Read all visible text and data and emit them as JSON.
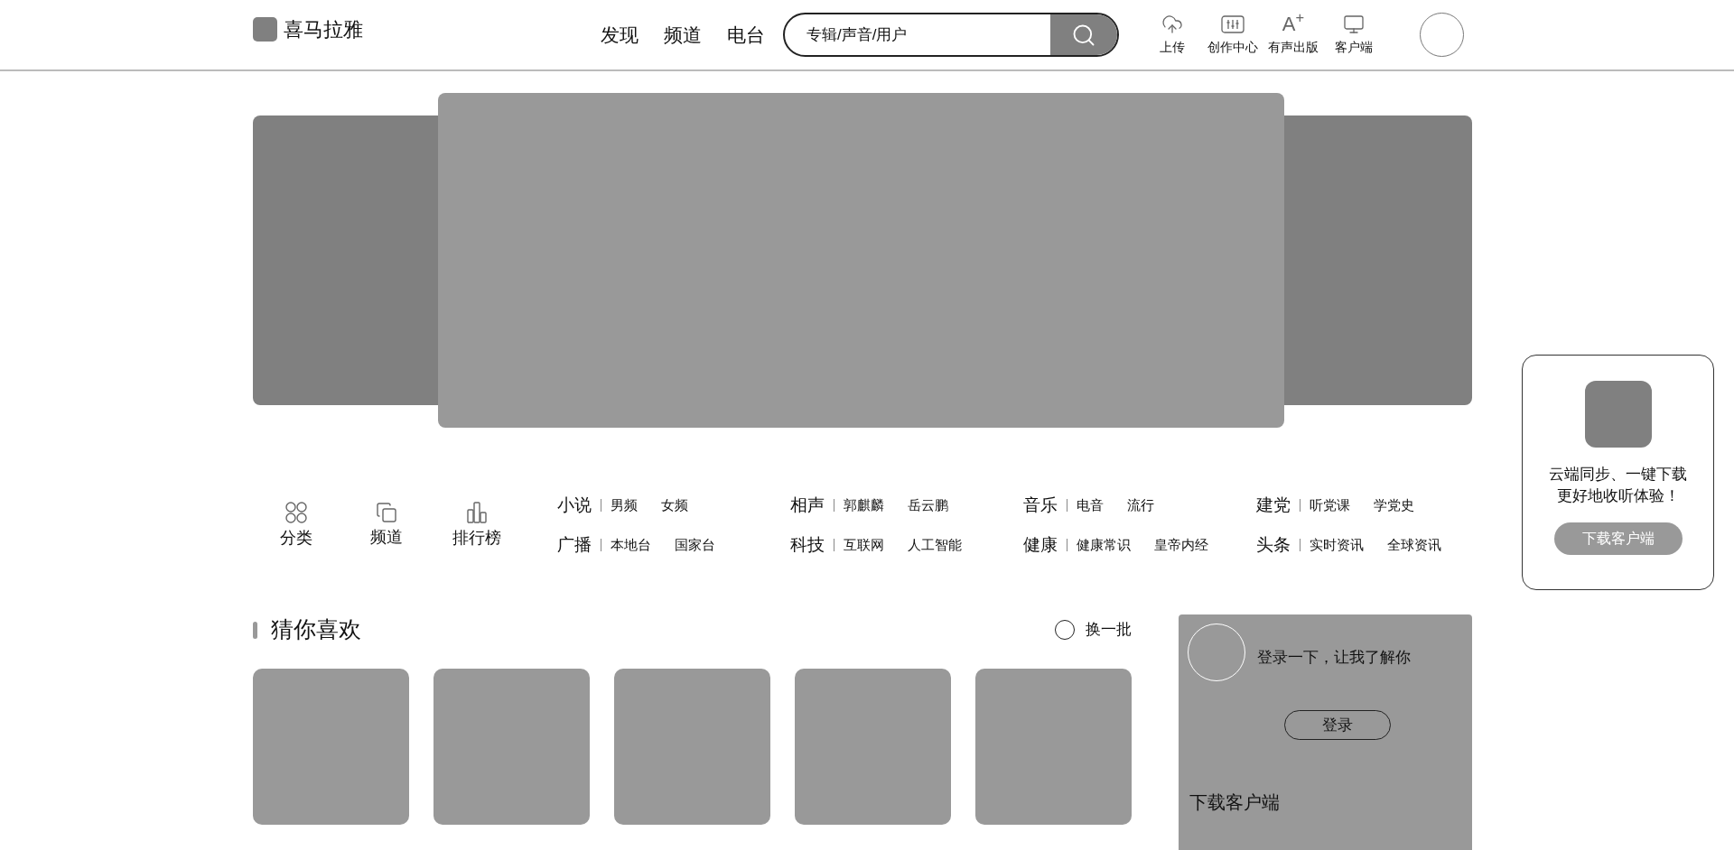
{
  "header": {
    "logo": "喜马拉雅",
    "nav": [
      {
        "label": "发现"
      },
      {
        "label": "频道"
      },
      {
        "label": "电台"
      }
    ],
    "search": {
      "placeholder": "专辑/声音/用户"
    },
    "tools": [
      {
        "kind": "upload",
        "label": "上传"
      },
      {
        "kind": "sliders",
        "label": "创作中心"
      },
      {
        "kind": "glyph",
        "glyph": "A$^{+}$",
        "label": "有声出版"
      },
      {
        "kind": "monitor",
        "label": "客户端"
      }
    ]
  },
  "shortcuts": [
    {
      "kind": "grid",
      "label": "分类"
    },
    {
      "kind": "copy",
      "label": "频道"
    },
    {
      "kind": "bars",
      "label": "排行榜"
    }
  ],
  "category_columns": [
    [
      {
        "name": "小说",
        "links": [
          "男频",
          "女频"
        ]
      },
      {
        "name": "广播",
        "links": [
          "本地台",
          "国家台"
        ]
      }
    ],
    [
      {
        "name": "相声",
        "links": [
          "郭麒麟",
          "岳云鹏"
        ]
      },
      {
        "name": "科技",
        "links": [
          "互联网",
          "人工智能"
        ]
      }
    ],
    [
      {
        "name": "音乐",
        "links": [
          "电音",
          "流行"
        ]
      },
      {
        "name": "健康",
        "links": [
          "健康常识",
          "皇帝内经"
        ]
      }
    ],
    [
      {
        "name": "建党",
        "links": [
          "听党课",
          "学党史"
        ]
      },
      {
        "name": "头条",
        "links": [
          "实时资讯",
          "全球资讯"
        ]
      }
    ]
  ],
  "recommend": {
    "title": "猜你喜欢",
    "refresh": "换一批",
    "items": [
      {
        "kind": "placeholder"
      },
      {
        "kind": "placeholder"
      },
      {
        "kind": "placeholder"
      },
      {
        "kind": "placeholder"
      },
      {
        "kind": "placeholder"
      }
    ]
  },
  "login_panel": {
    "prompt": "登录一下，让我了解你",
    "button": "登录",
    "download_title": "下载客户端"
  },
  "download_card": {
    "text": [
      "云端同步、一键下载",
      "更好地收听体验！"
    ],
    "button": "下载客户端"
  }
}
